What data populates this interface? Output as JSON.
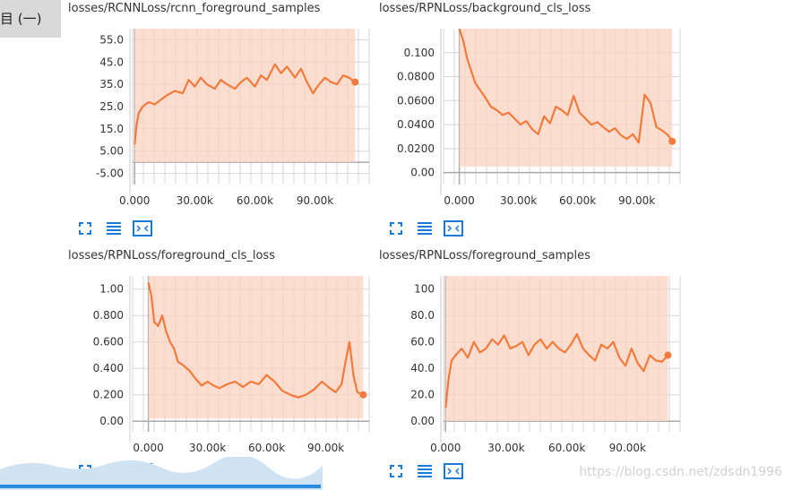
{
  "header": {
    "fragment": "目 (一)"
  },
  "watermark": "https://blog.csdn.net/zdsdn1996",
  "buttons": [
    {
      "name": "fullscreen-icon"
    },
    {
      "name": "data-list-icon"
    },
    {
      "name": "fit-domain-icon"
    }
  ],
  "colors": {
    "line": "#f47a3b",
    "band": "#fbd3c2",
    "grid": "#d7d7d7",
    "axis": "#aaaaaa",
    "button": "#1a7ad8"
  },
  "chart_data": [
    {
      "type": "line",
      "title": "losses/RCNNLoss/rcnn_foreground_samples",
      "xticks": [
        "0.000",
        "30.00k",
        "60.00k",
        "90.00k"
      ],
      "xtick_values": [
        0,
        30000,
        60000,
        90000
      ],
      "yticks": [
        "55.0",
        "45.0",
        "35.0",
        "25.0",
        "15.0",
        "5.00",
        "-5.00"
      ],
      "ytick_values": [
        55,
        45,
        35,
        25,
        15,
        5,
        -5
      ],
      "xlim": [
        -1000,
        117000
      ],
      "ylim": [
        -10,
        60
      ],
      "band": {
        "x_start": 0,
        "x_end": 110000,
        "lower": 0,
        "upper": 60
      },
      "series": [
        {
          "x": [
            0,
            1000,
            2000,
            4000,
            7000,
            10000,
            13000,
            16000,
            20000,
            24000,
            27000,
            30000,
            33000,
            36000,
            40000,
            43000,
            46000,
            50000,
            53000,
            56000,
            60000,
            63000,
            66000,
            70000,
            73000,
            76000,
            80000,
            83000,
            86000,
            89000,
            92000,
            95000,
            98000,
            101000,
            104000,
            107000,
            110000
          ],
          "y": [
            8,
            17,
            22,
            25,
            27,
            26,
            28,
            30,
            32,
            31,
            37,
            34,
            38,
            35,
            33,
            37,
            35,
            33,
            36,
            38,
            34,
            39,
            37,
            44,
            40,
            43,
            38,
            42,
            36,
            31,
            35,
            38,
            36,
            35,
            39,
            38,
            36
          ]
        }
      ],
      "last_point": {
        "x": 110000,
        "y": 36
      }
    },
    {
      "type": "line",
      "title": "losses/RPNLoss/background_cls_loss",
      "xticks": [
        "0.000",
        "30.00k",
        "60.00k",
        "90.00k"
      ],
      "xtick_values": [
        0,
        30000,
        60000,
        90000
      ],
      "yticks": [
        "0.100",
        "0.0800",
        "0.0600",
        "0.0400",
        "0.0200",
        "0.00"
      ],
      "ytick_values": [
        0.1,
        0.08,
        0.06,
        0.04,
        0.02,
        0
      ],
      "xlim": [
        -8000,
        112000
      ],
      "ylim": [
        -0.01,
        0.12
      ],
      "band": {
        "x_start": 0,
        "x_end": 108000,
        "lower": 0.005,
        "upper": 0.12
      },
      "series": [
        {
          "x": [
            0,
            2000,
            4000,
            6000,
            8000,
            10000,
            13000,
            16000,
            19000,
            22000,
            25000,
            28000,
            31000,
            34000,
            37000,
            40000,
            43000,
            46000,
            49000,
            52000,
            55000,
            58000,
            61000,
            64000,
            67000,
            70000,
            73000,
            76000,
            79000,
            82000,
            85000,
            88000,
            91000,
            94000,
            97000,
            100000,
            103000,
            106000,
            108000
          ],
          "y": [
            0.12,
            0.11,
            0.095,
            0.085,
            0.075,
            0.07,
            0.063,
            0.055,
            0.052,
            0.048,
            0.05,
            0.045,
            0.04,
            0.043,
            0.036,
            0.032,
            0.047,
            0.041,
            0.055,
            0.052,
            0.048,
            0.064,
            0.05,
            0.045,
            0.04,
            0.042,
            0.038,
            0.034,
            0.037,
            0.031,
            0.028,
            0.032,
            0.025,
            0.065,
            0.058,
            0.038,
            0.035,
            0.031,
            0.026
          ]
        }
      ],
      "last_point": {
        "x": 108000,
        "y": 0.026
      }
    },
    {
      "type": "line",
      "title": "losses/RPNLoss/foreground_cls_loss",
      "xticks": [
        "0.000",
        "30.00k",
        "60.00k",
        "90.00k"
      ],
      "xtick_values": [
        0,
        30000,
        60000,
        90000
      ],
      "yticks": [
        "1.00",
        "0.800",
        "0.600",
        "0.400",
        "0.200",
        "0.00"
      ],
      "ytick_values": [
        1,
        0.8,
        0.6,
        0.4,
        0.2,
        0
      ],
      "xlim": [
        -8000,
        112000
      ],
      "ylim": [
        -0.08,
        1.1
      ],
      "band": {
        "x_start": 0,
        "x_end": 109000,
        "lower": 0.02,
        "upper": 1.1
      },
      "series": [
        {
          "x": [
            0,
            1500,
            3000,
            5000,
            7000,
            9000,
            11000,
            13000,
            15000,
            18000,
            21000,
            24000,
            27000,
            30000,
            33000,
            36000,
            40000,
            44000,
            48000,
            52000,
            56000,
            60000,
            64000,
            68000,
            72000,
            76000,
            80000,
            84000,
            88000,
            92000,
            95000,
            98000,
            100000,
            102000,
            104000,
            106000,
            109000
          ],
          "y": [
            1.05,
            0.95,
            0.75,
            0.72,
            0.8,
            0.68,
            0.6,
            0.55,
            0.45,
            0.42,
            0.38,
            0.32,
            0.27,
            0.3,
            0.27,
            0.25,
            0.28,
            0.3,
            0.26,
            0.3,
            0.28,
            0.35,
            0.3,
            0.23,
            0.2,
            0.18,
            0.2,
            0.24,
            0.3,
            0.25,
            0.22,
            0.28,
            0.45,
            0.6,
            0.35,
            0.22,
            0.2
          ]
        }
      ],
      "last_point": {
        "x": 109000,
        "y": 0.2
      }
    },
    {
      "type": "line",
      "title": "losses/RPNLoss/foreground_samples",
      "xticks": [
        "0.000",
        "30.00k",
        "60.00k",
        "90.00k"
      ],
      "xtick_values": [
        0,
        30000,
        60000,
        90000
      ],
      "yticks": [
        "100",
        "80.0",
        "60.0",
        "40.0",
        "20.0",
        "0.00"
      ],
      "ytick_values": [
        100,
        80,
        60,
        40,
        20,
        0
      ],
      "xlim": [
        -1000,
        116000
      ],
      "ylim": [
        -8,
        110
      ],
      "band": {
        "x_start": 0,
        "x_end": 110000,
        "lower": 0,
        "upper": 110
      },
      "series": [
        {
          "x": [
            0,
            1500,
            3000,
            5000,
            8000,
            11000,
            14000,
            17000,
            20000,
            23000,
            26000,
            29000,
            32000,
            35000,
            38000,
            41000,
            44000,
            47000,
            50000,
            53000,
            56000,
            59000,
            62000,
            65000,
            68000,
            71000,
            74000,
            77000,
            80000,
            83000,
            86000,
            89000,
            92000,
            95000,
            98000,
            101000,
            104000,
            107000,
            110000
          ],
          "y": [
            10,
            32,
            46,
            50,
            55,
            48,
            60,
            52,
            55,
            62,
            58,
            65,
            55,
            57,
            60,
            50,
            58,
            62,
            55,
            60,
            55,
            52,
            58,
            66,
            55,
            50,
            46,
            58,
            55,
            60,
            48,
            42,
            55,
            44,
            38,
            50,
            46,
            45,
            50
          ]
        }
      ],
      "last_point": {
        "x": 110000,
        "y": 50
      }
    }
  ]
}
